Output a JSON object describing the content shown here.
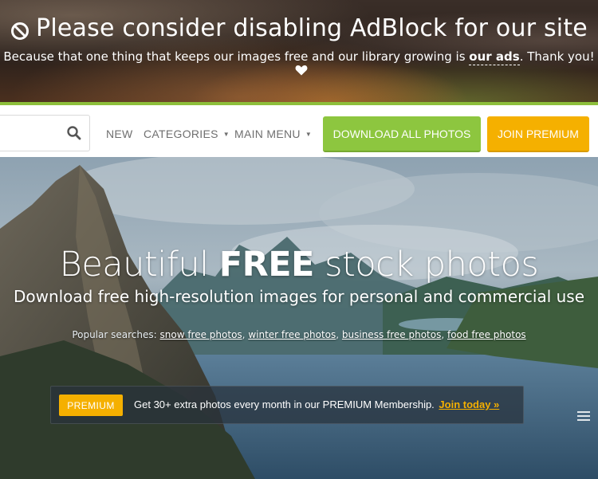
{
  "adblock": {
    "title": "Please consider disabling AdBlock for our site",
    "subtitle_before": "Because that one thing that keeps our images free and our library growing is ",
    "subtitle_highlight": "our ads",
    "subtitle_after": ". Thank you!",
    "icons": [
      "ban-icon",
      "heart-icon"
    ]
  },
  "nav": {
    "search": {
      "value": "",
      "icon": "search-icon"
    },
    "links": [
      {
        "label": "NEW"
      },
      {
        "label": "CATEGORIES",
        "has_dropdown": true
      },
      {
        "label": "MAIN MENU",
        "has_dropdown": true
      }
    ],
    "download_button": "DOWNLOAD ALL PHOTOS",
    "premium_button": "JOIN PREMIUM",
    "colors": {
      "accent_green": "#8dc63f",
      "accent_yellow": "#f5b000"
    }
  },
  "hero": {
    "title_light_1": "Beautiful ",
    "title_bold": "FREE",
    "title_light_2": " stock photos",
    "subtitle": "Download free high-resolution images for personal and commercial use",
    "popular_label": "Popular searches:",
    "popular_searches": [
      "snow free photos",
      "winter free photos",
      "business free photos",
      "food free photos"
    ],
    "premium_bar": {
      "badge": "PREMIUM",
      "text": "Get 30+ extra photos every month in our PREMIUM Membership.",
      "link": "Join today »"
    }
  }
}
